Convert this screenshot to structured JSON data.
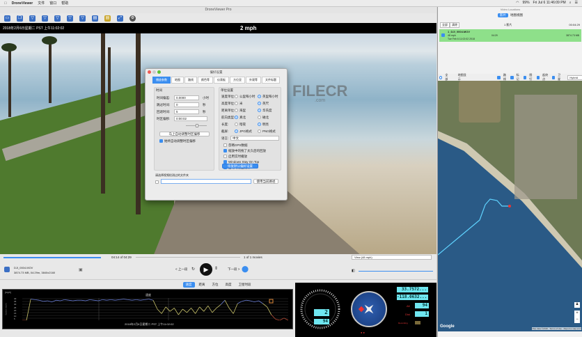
{
  "menubar": {
    "apple": "",
    "app": "DroneViewer",
    "items": [
      "文件",
      "窗口",
      "帮助"
    ],
    "status": {
      "battery": "99%",
      "clock": "Fri Jul 6  11:46:09 PM"
    }
  },
  "window": {
    "title": "DroneViewer Pro"
  },
  "toolbar": {
    "icons": [
      "open-icon",
      "copy-icon",
      "cup-icon-1",
      "cup-icon-2",
      "cup-icon-3",
      "cup-icon-4",
      "cup-icon-5",
      "save-icon",
      "export-icon",
      "fullscreen-icon",
      "settings-icon"
    ]
  },
  "video": {
    "datetime": "2018年2月6日星期二 PST 上午11:02:02",
    "speed": "2 mph",
    "watermark": "FILECR",
    ".com": ".com",
    "watermark_sub": ".com"
  },
  "dialog": {
    "title": "偏好设置",
    "tabs": [
      "播放参数",
      "地图",
      "路线",
      "颜色等",
      "仪表板",
      "方位显",
      "外观等",
      "文件标题"
    ],
    "left_group_title": "时间",
    "fields": [
      {
        "label": "时间偏差:",
        "value": "0.0000",
        "unit": "小时"
      },
      {
        "label": "跳过时间:",
        "value": "0",
        "unit": "秒"
      },
      {
        "label": "回退时间:",
        "value": "5",
        "unit": "秒"
      },
      {
        "label": "时区偏移:",
        "value": "0:00:02",
        "unit": ""
      }
    ],
    "auto_sync_button": "马上自动调整时区偏移",
    "auto_sync_check": "始终自动调整时区偏移",
    "right_group_title": "单位设置",
    "unit_rows": [
      {
        "label": "速度单位:",
        "a": "公里每小时",
        "b": "英里每小时",
        "sel": "b"
      },
      {
        "label": "高度单位:",
        "a": "米",
        "b": "英尺",
        "sel": "b"
      },
      {
        "label": "距离单位:",
        "a": "海里",
        "b": "华氏度",
        "sel": "b"
      },
      {
        "label": "航向类型:",
        "a": "真北",
        "b": "磁北",
        "sel": "a"
      },
      {
        "label": "长度:",
        "a": "暗夜",
        "b": "明亮",
        "sel": "b"
      },
      {
        "label": "截屏:",
        "a": "JPG格式",
        "b": "PNG格式",
        "sel": "a"
      }
    ],
    "language_label": "语言:",
    "language_value": "中文",
    "checks": [
      {
        "label": "忽略GPS数据",
        "on": false
      },
      {
        "label": "缩放中的拖了太久后的回放",
        "on": true
      },
      {
        "label": "启用实时播放",
        "on": false
      },
      {
        "label": "Windows Stay On Top",
        "on": true
      },
      {
        "label": "启动时检查更新",
        "on": true
      }
    ],
    "reset_button": "恢复默认偏好设置",
    "folder_label": "请选择视频检测过的文件夹",
    "folder_value": "",
    "folder_button": "使用当前路径"
  },
  "timeline": {
    "time": "04:14 of 04:29",
    "clips": "1 of 1 movies",
    "progress": 0.69
  },
  "controls": {
    "file_name": "DJI_0004.MOV",
    "file_info": "3874.73 MB, 04:29m, 3840x2160",
    "prev": "< 上一段",
    "next": "下一段 >",
    "view_label": "View (48 mph)"
  },
  "bottom_tabs": [
    "速度",
    "距离",
    "方位",
    "高度",
    "卫星时段"
  ],
  "speed_chart": {
    "title": "速度",
    "ylabel": "Speed (mph)",
    "unit": "(mph)",
    "xlabel": "2018年2月6日星期二 PST 上午11:02:02",
    "yticks": [
      "40",
      "35",
      "30",
      "25",
      "20",
      "15",
      "10",
      "5"
    ],
    "values": [
      0,
      0,
      38,
      37,
      36,
      34,
      35,
      33,
      36,
      35,
      37,
      36,
      35,
      36,
      36,
      35,
      37,
      36,
      35,
      37,
      36,
      37,
      36,
      37,
      38,
      37,
      36,
      37,
      36,
      37,
      38,
      36,
      20,
      12,
      24,
      16,
      22,
      10,
      20,
      14,
      22,
      12,
      24,
      16,
      26,
      14,
      22,
      28,
      36,
      22,
      12,
      30,
      34,
      36,
      35,
      33,
      35,
      30,
      24,
      10,
      2,
      0,
      4,
      0
    ]
  },
  "instruments": {
    "speed": "2",
    "altitude": "94",
    "lat": "33.7572...",
    "lon": "-118.0632...",
    "alt_label": "Alt",
    "dist_label": "Dist",
    "alt_value": "94",
    "dist_value": "1",
    "rec_label": "Recording"
  },
  "right_panel": {
    "title": "Video Locations",
    "tabs": [
      "影片",
      "地图视图"
    ],
    "list_buttons": [
      "全部",
      "清除"
    ],
    "count": "1 影片",
    "total": "00:04:29",
    "item": {
      "name": "1_DJI_0004.MOV",
      "speed": "48 mph",
      "date": "Tue Feb 6 11:02:02 2018",
      "duration": "04:29",
      "size": "3874.73 MB"
    },
    "map_toolbar": {
      "all": "全部",
      "route": "地图显示",
      "checks": [
        "路线",
        "标记",
        "图钉",
        "起终点",
        "卫星"
      ],
      "map_type": "Hybrid"
    },
    "map_footer": {
      "google": "Google",
      "terms": "Map data ©2018 · Terms of Use · Report a map error"
    }
  }
}
